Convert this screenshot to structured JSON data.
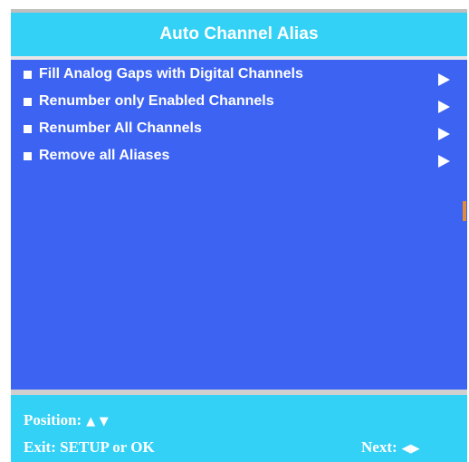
{
  "title": "Auto Channel Alias",
  "menu": {
    "items": [
      {
        "label": "Fill Analog Gaps with Digital Channels",
        "arrow_icon": "arrow-right-icon"
      },
      {
        "label": "Renumber only Enabled Channels",
        "arrow_icon": "arrow-right-icon"
      },
      {
        "label": "Renumber All Channels",
        "arrow_icon": "arrow-right-icon"
      },
      {
        "label": "Remove all Aliases",
        "arrow_icon": "arrow-right-icon"
      }
    ]
  },
  "footer": {
    "position_label": "Position:",
    "position_glyphs": "▲ ▼",
    "exit_label": "Exit: SETUP or OK",
    "next_label": "Next:",
    "next_glyphs": "◀▶"
  },
  "colors": {
    "title_bar": "#33d1f5",
    "menu_background": "#3d63f2",
    "footer_background": "#33d1f5",
    "text": "#ffffff"
  }
}
